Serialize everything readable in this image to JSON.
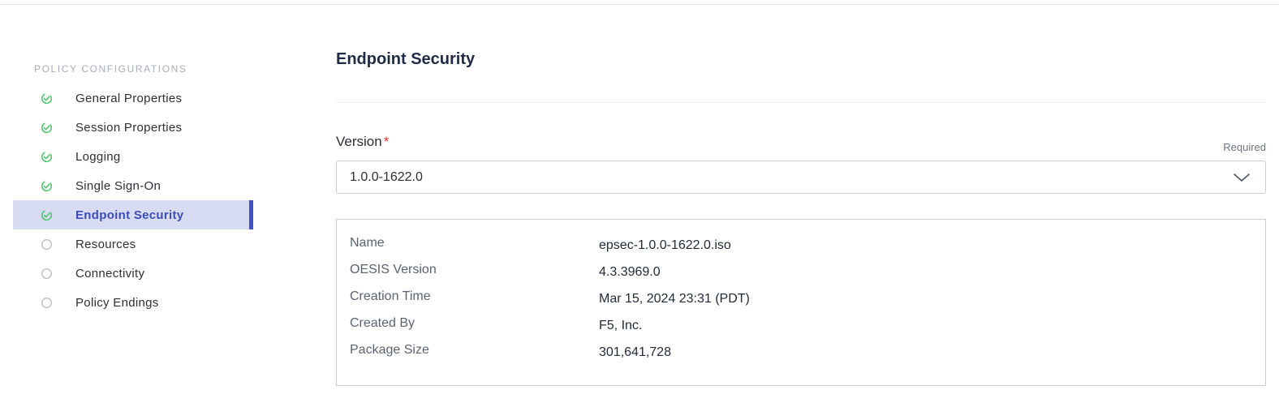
{
  "sidebar": {
    "heading": "POLICY CONFIGURATIONS",
    "items": [
      {
        "label": "General Properties",
        "status": "complete"
      },
      {
        "label": "Session Properties",
        "status": "complete"
      },
      {
        "label": "Logging",
        "status": "complete"
      },
      {
        "label": "Single Sign-On",
        "status": "complete"
      },
      {
        "label": "Endpoint Security",
        "status": "complete",
        "active": true
      },
      {
        "label": "Resources",
        "status": "incomplete"
      },
      {
        "label": "Connectivity",
        "status": "incomplete"
      },
      {
        "label": "Policy Endings",
        "status": "incomplete"
      }
    ]
  },
  "main": {
    "title": "Endpoint Security",
    "version_field": {
      "label": "Version",
      "required_mark": "*",
      "required_hint": "Required",
      "selected_value": "1.0.0-1622.0"
    },
    "details": [
      {
        "key": "Name",
        "value": "epsec-1.0.0-1622.0.iso"
      },
      {
        "key": "OESIS Version",
        "value": "4.3.3969.0"
      },
      {
        "key": "Creation Time",
        "value": "Mar 15, 2024 23:31 (PDT)"
      },
      {
        "key": "Created By",
        "value": "F5, Inc."
      },
      {
        "key": "Package Size",
        "value": "301,641,728"
      }
    ]
  },
  "colors": {
    "complete": "#4cc46a",
    "incomplete": "#b8bcc4",
    "active_bg": "#d8dcf2",
    "active_accent": "#3e51c4"
  }
}
